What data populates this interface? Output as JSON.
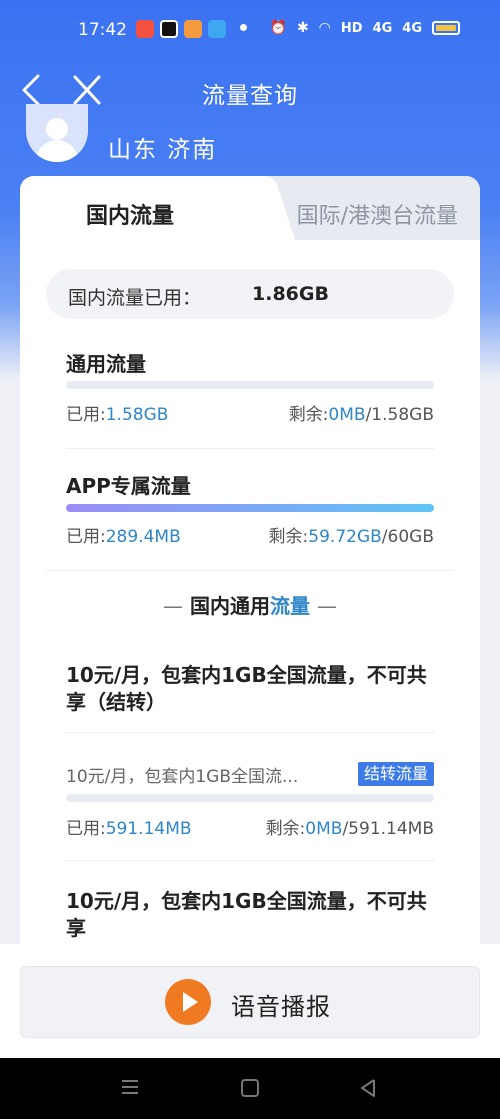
{
  "status_bar": {
    "time": "17:42",
    "hd": "HD",
    "signal_1": "4G",
    "signal_2": "4G"
  },
  "nav": {
    "title": "流量查询"
  },
  "user": {
    "location": "山东  济南"
  },
  "tabs": {
    "domestic": "国内流量",
    "international": "国际/港澳台流量"
  },
  "summary": {
    "label": "国内流量已用：",
    "value": "1.86GB"
  },
  "general": {
    "title": "通用流量",
    "used_label": "已用:",
    "used_value": "1.58GB",
    "remain_label": "剩余:",
    "remain_value": "0MB",
    "total": "/1.58GB",
    "progress": 0
  },
  "app": {
    "title": "APP专属流量",
    "used_label": "已用:",
    "used_value": "289.4MB",
    "remain_label": "剩余:",
    "remain_value": "59.72GB",
    "total": "/60GB",
    "progress": 1
  },
  "domestic_general": {
    "dash_left": "—",
    "heading_a": "国内通用",
    "heading_b": "流量",
    "dash_right": "—"
  },
  "package1": {
    "title": "10元/月，包套内1GB全国流量，不可共享（结转）",
    "desc": "10元/月，包套内1GB全国流...",
    "tag": "结转流量",
    "used_label": "已用:",
    "used_value": "591.14MB",
    "remain_label": "剩余:",
    "remain_value": "0MB",
    "total": "/591.14MB"
  },
  "package2": {
    "title": "10元/月，包套内1GB全国流量，不可共享"
  },
  "voice": {
    "label": "语音播报"
  },
  "colors": {
    "primary": "#3a72f2",
    "accent_blue": "#2f86c8",
    "tag_blue": "#3c7be8",
    "voice_orange": "#f07a22"
  }
}
